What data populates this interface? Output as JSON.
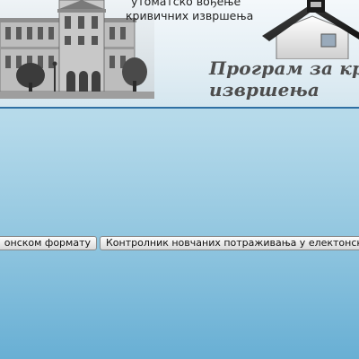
{
  "header": {
    "slogan_line1": "утоматско вођење",
    "slogan_line2": "кривичних извршења",
    "program_title_line1": "Програм за кри",
    "program_title_line2": "извршења"
  },
  "buttons": {
    "format": "онском формату",
    "controller": "Контролник новчаних потраживања у електонско"
  },
  "colors": {
    "header_line": "#2f6fa3",
    "background_top": "#c9e3ef",
    "background_bottom": "#68afd4"
  }
}
